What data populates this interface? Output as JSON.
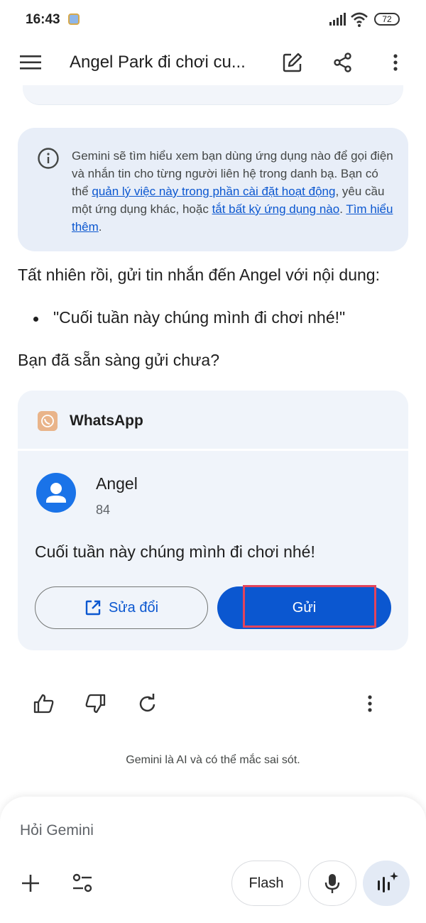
{
  "status_bar": {
    "time": "16:43",
    "battery": "72",
    "icons": [
      "app-notification-icon",
      "signal-icon",
      "wifi-icon",
      "battery-icon"
    ]
  },
  "app_bar": {
    "title": "Angel Park đi chơi cu...",
    "icons": [
      "menu-icon",
      "edit-icon",
      "share-icon",
      "more-vert-icon"
    ]
  },
  "info_card": {
    "text_before": "Gemini sẽ tìm hiểu xem bạn dùng ứng dụng nào để gọi điện và nhắn tin cho từng người liên hệ trong danh bạ. Bạn có thể ",
    "link_manage": "quản lý việc này trong phần cài đặt hoạt động",
    "text_middle": ", yêu cầu một ứng dụng khác, hoặc ",
    "link_disable": "tắt bất kỳ ứng dụng nào",
    "text_sep": ". ",
    "link_learn": "Tìm hiểu thêm",
    "text_end": "."
  },
  "response": {
    "intro": "Tất nhiên rồi, gửi tin nhắn đến Angel với nội dung:",
    "bullet": "\"Cuối tuần này chúng mình đi chơi nhé!\"",
    "question": "Bạn đã sẵn sàng gửi chưa?"
  },
  "whatsapp_card": {
    "app_name": "WhatsApp",
    "contact_name": "Angel",
    "contact_number": "84",
    "message": "Cuối tuần này chúng mình đi chơi nhé!",
    "edit_label": "Sửa đổi",
    "send_label": "Gửi"
  },
  "feedback": {
    "icons": [
      "thumb-up-icon",
      "thumb-down-icon",
      "retry-icon",
      "more-vert-icon"
    ]
  },
  "disclaimer": "Gemini là AI và có thể mắc sai sót.",
  "composer": {
    "placeholder": "Hỏi Gemini",
    "model_label": "Flash",
    "icons": [
      "add-icon",
      "tools-icon",
      "mic-icon",
      "live-icon"
    ]
  },
  "colors": {
    "accent": "#0b57d0",
    "card_background": "#e8eef8",
    "highlight": "#e2445c"
  }
}
